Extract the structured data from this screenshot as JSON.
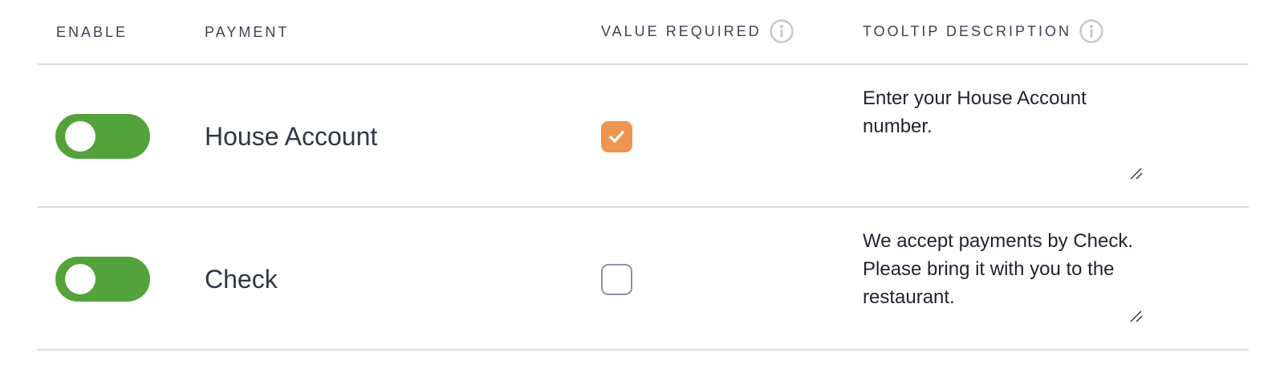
{
  "headers": {
    "enable": "ENABLE",
    "payment": "PAYMENT",
    "value_required": "VALUE REQUIRED",
    "tooltip_description": "TOOLTIP DESCRIPTION"
  },
  "icons": {
    "info": "info-icon",
    "check": "checkmark-icon",
    "resize": "resize-handle-icon"
  },
  "colors": {
    "toggle_on": "#53a23b",
    "checkbox_checked": "#ee9550",
    "checkbox_border": "#8f93a3",
    "divider": "#dcdcdc",
    "info_icon": "#c8c8c8"
  },
  "rows": [
    {
      "enabled": true,
      "payment": "House Account",
      "value_required": true,
      "tooltip": "Enter your House Account number."
    },
    {
      "enabled": true,
      "payment": "Check",
      "value_required": false,
      "tooltip": "We accept payments by Check. Please bring it with you to the restaurant."
    }
  ]
}
